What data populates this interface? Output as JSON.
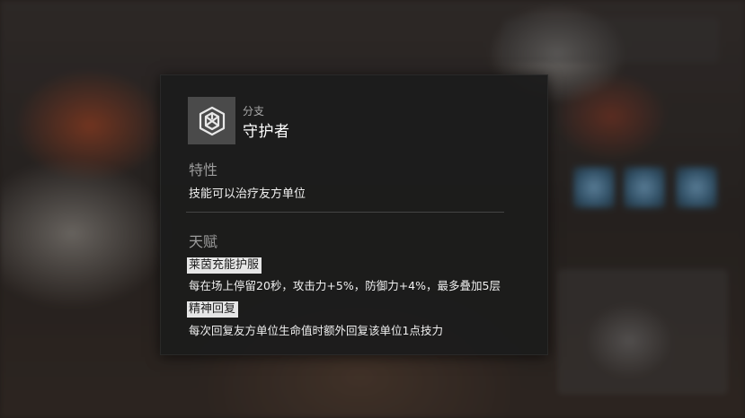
{
  "branch": {
    "caption": "分支",
    "name": "守护者",
    "icon": "guardian-shield-icon"
  },
  "trait": {
    "title": "特性",
    "text": "技能可以治疗友方单位"
  },
  "talent": {
    "title": "天赋",
    "items": [
      {
        "name": "莱茵充能护服",
        "desc": "每在场上停留20秒，攻击力+5%，防御力+4%，最多叠加5层"
      },
      {
        "name": "精神回复",
        "desc": "每次回复友方单位生命值时额外回复该单位1点技力"
      }
    ]
  },
  "colors": {
    "panel_bg": "#1c1c1c",
    "icon_box_bg": "#4a4a4a",
    "section_title": "#9c9c9c",
    "talent_tag_bg": "#e6e6e6"
  }
}
